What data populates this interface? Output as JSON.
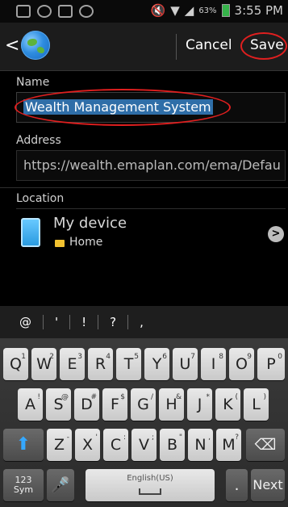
{
  "status_bar": {
    "battery": "63%",
    "time": "3:55 PM"
  },
  "action_bar": {
    "cancel_label": "Cancel",
    "save_label": "Save"
  },
  "form": {
    "name_label": "Name",
    "name_value": "Wealth Management System",
    "address_label": "Address",
    "address_value": "https://wealth.emaplan.com/ema/Defau",
    "location_label": "Location",
    "location_title": "My device",
    "location_folder": "Home"
  },
  "keyboard": {
    "suggestions": [
      "@",
      "'",
      "!",
      "?",
      ","
    ],
    "row1": [
      {
        "k": "Q",
        "s": "1"
      },
      {
        "k": "W",
        "s": "2"
      },
      {
        "k": "E",
        "s": "3"
      },
      {
        "k": "R",
        "s": "4"
      },
      {
        "k": "T",
        "s": "5"
      },
      {
        "k": "Y",
        "s": "6"
      },
      {
        "k": "U",
        "s": "7"
      },
      {
        "k": "I",
        "s": "8"
      },
      {
        "k": "O",
        "s": "9"
      },
      {
        "k": "P",
        "s": "0"
      }
    ],
    "row2": [
      {
        "k": "A",
        "s": "!"
      },
      {
        "k": "S",
        "s": "@"
      },
      {
        "k": "D",
        "s": "#"
      },
      {
        "k": "F",
        "s": "$"
      },
      {
        "k": "G",
        "s": "/"
      },
      {
        "k": "H",
        "s": "&"
      },
      {
        "k": "J",
        "s": "*"
      },
      {
        "k": "K",
        "s": "("
      },
      {
        "k": "L",
        "s": ")"
      }
    ],
    "row3": [
      {
        "k": "Z",
        "s": "-"
      },
      {
        "k": "X",
        "s": "'"
      },
      {
        "k": "C",
        "s": ":"
      },
      {
        "k": "V",
        "s": ";"
      },
      {
        "k": "B",
        "s": "\""
      },
      {
        "k": "N",
        "s": ","
      },
      {
        "k": "M",
        "s": "?"
      }
    ],
    "sym_label_1": "123",
    "sym_label_2": "Sym",
    "space_label": "English(US)",
    "next_label": "Next"
  }
}
